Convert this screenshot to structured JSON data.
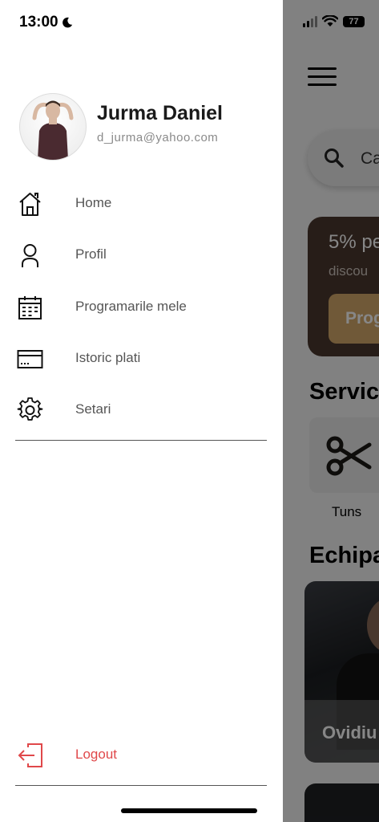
{
  "status_bar": {
    "time": "13:00",
    "battery": "77"
  },
  "drawer": {
    "user": {
      "name": "Jurma Daniel",
      "email": "d_jurma@yahoo.com"
    },
    "menu": [
      {
        "label": "Home",
        "icon": "home-icon"
      },
      {
        "label": "Profil",
        "icon": "user-icon"
      },
      {
        "label": "Programarile mele",
        "icon": "calendar-icon"
      },
      {
        "label": "Istoric plati",
        "icon": "credit-card-icon"
      },
      {
        "label": "Setari",
        "icon": "gear-icon"
      }
    ],
    "logout": {
      "label": "Logout",
      "icon": "logout-icon",
      "color": "#e0484a"
    }
  },
  "background": {
    "search_placeholder": "Ca",
    "promo": {
      "title": "5% pe",
      "subtitle": "discou",
      "button": "Prog"
    },
    "services_title": "Servic",
    "services": [
      {
        "label": "Tuns",
        "icon": "scissors-icon"
      }
    ],
    "team_title": "Echipa",
    "team": [
      {
        "name": "Ovidiu"
      }
    ]
  },
  "colors": {
    "promo_bg": "#4a372f",
    "promo_button": "#d4a86a",
    "logout": "#e0484a"
  }
}
